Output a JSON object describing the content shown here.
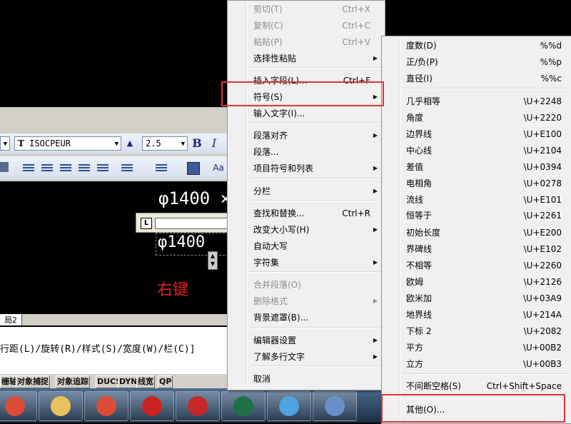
{
  "toolbar": {
    "font_value": "ISOCPEUR",
    "font_icon": "truetype-icon",
    "size_value": "2.5",
    "bold_label": "B",
    "italic_label": "I",
    "aa_label": "Aa"
  },
  "drawing": {
    "top_text": "φ1400 ×",
    "edit_text": "φ1400",
    "right_click_label": "右键",
    "ruler_l": "L",
    "layout_tab": "局2"
  },
  "command_line": {
    "text": "行距(L)/旋转(R)/样式(S)/宽度(W)/栏(C)]"
  },
  "status_bar": [
    "栅轴",
    "对象捕捉",
    "对象追踪",
    "DUCS",
    "DYN",
    "线宽",
    "QP"
  ],
  "taskbar_apps": [
    {
      "icon": "chrome-icon",
      "color": "#dd4b39"
    },
    {
      "icon": "folder-icon",
      "color": "#e8c25a"
    },
    {
      "icon": "chrome-icon",
      "color": "#dd4b39"
    },
    {
      "icon": "pdf-icon",
      "color": "#cc2222"
    },
    {
      "icon": "autocad-icon",
      "color": "#c42828"
    },
    {
      "icon": "excel-icon",
      "color": "#1e7145"
    },
    {
      "icon": "qq-icon",
      "color": "#4ea3e0"
    },
    {
      "icon": "translate-icon",
      "color": "#6a8fc8"
    }
  ],
  "context_menu": {
    "items": [
      {
        "label": "剪切(T)",
        "shortcut": "Ctrl+X",
        "disabled": true
      },
      {
        "label": "复制(C)",
        "shortcut": "Ctrl+C",
        "disabled": true
      },
      {
        "label": "粘贴(P)",
        "shortcut": "Ctrl+V",
        "disabled": true
      },
      {
        "label": "选择性粘贴",
        "submenu": true
      },
      {
        "label": "插入字段(L)...",
        "shortcut": "Ctrl+F"
      },
      {
        "label": "符号(S)",
        "submenu": true,
        "highlighted": true
      },
      {
        "label": "输入文字(I)..."
      },
      {
        "label": "段落对齐",
        "submenu": true
      },
      {
        "label": "段落..."
      },
      {
        "label": "项目符号和列表",
        "submenu": true
      },
      {
        "label": "分栏",
        "submenu": true
      },
      {
        "label": "查找和替换...",
        "shortcut": "Ctrl+R"
      },
      {
        "label": "改变大小写(H)",
        "submenu": true
      },
      {
        "label": "自动大写"
      },
      {
        "label": "字符集",
        "submenu": true
      },
      {
        "label": "合并段落(O)",
        "disabled": true
      },
      {
        "label": "删除格式",
        "submenu": true,
        "disabled": true
      },
      {
        "label": "背景遮罩(B)..."
      },
      {
        "label": "编辑器设置",
        "submenu": true
      },
      {
        "label": "了解多行文字",
        "submenu": true
      },
      {
        "label": "取消"
      }
    ]
  },
  "symbol_menu": {
    "items": [
      {
        "label": "度数(D)",
        "code": "%%d"
      },
      {
        "label": "正/负(P)",
        "code": "%%p"
      },
      {
        "label": "直径(I)",
        "code": "%%c"
      },
      {
        "label": "几乎相等",
        "code": "\\U+2248"
      },
      {
        "label": "角度",
        "code": "\\U+2220"
      },
      {
        "label": "边界线",
        "code": "\\U+E100"
      },
      {
        "label": "中心线",
        "code": "\\U+2104"
      },
      {
        "label": "差值",
        "code": "\\U+0394"
      },
      {
        "label": "电相角",
        "code": "\\U+0278"
      },
      {
        "label": "流线",
        "code": "\\U+E101"
      },
      {
        "label": "恒等于",
        "code": "\\U+2261"
      },
      {
        "label": "初始长度",
        "code": "\\U+E200"
      },
      {
        "label": "界碑线",
        "code": "\\U+E102"
      },
      {
        "label": "不相等",
        "code": "\\U+2260"
      },
      {
        "label": "欧姆",
        "code": "\\U+2126"
      },
      {
        "label": "欧米加",
        "code": "\\U+03A9"
      },
      {
        "label": "地界线",
        "code": "\\U+214A"
      },
      {
        "label": "下标 2",
        "code": "\\U+2082"
      },
      {
        "label": "平方",
        "code": "\\U+00B2"
      },
      {
        "label": "立方",
        "code": "\\U+00B3"
      },
      {
        "label": "不间断空格(S)",
        "code": "Ctrl+Shift+Space"
      },
      {
        "label": "其他(O)...",
        "highlighted": true
      }
    ]
  },
  "colors": {
    "highlight_border": "#e0343a",
    "menu_bg": "#f0f0f0",
    "right_click_label": "#e02020"
  }
}
